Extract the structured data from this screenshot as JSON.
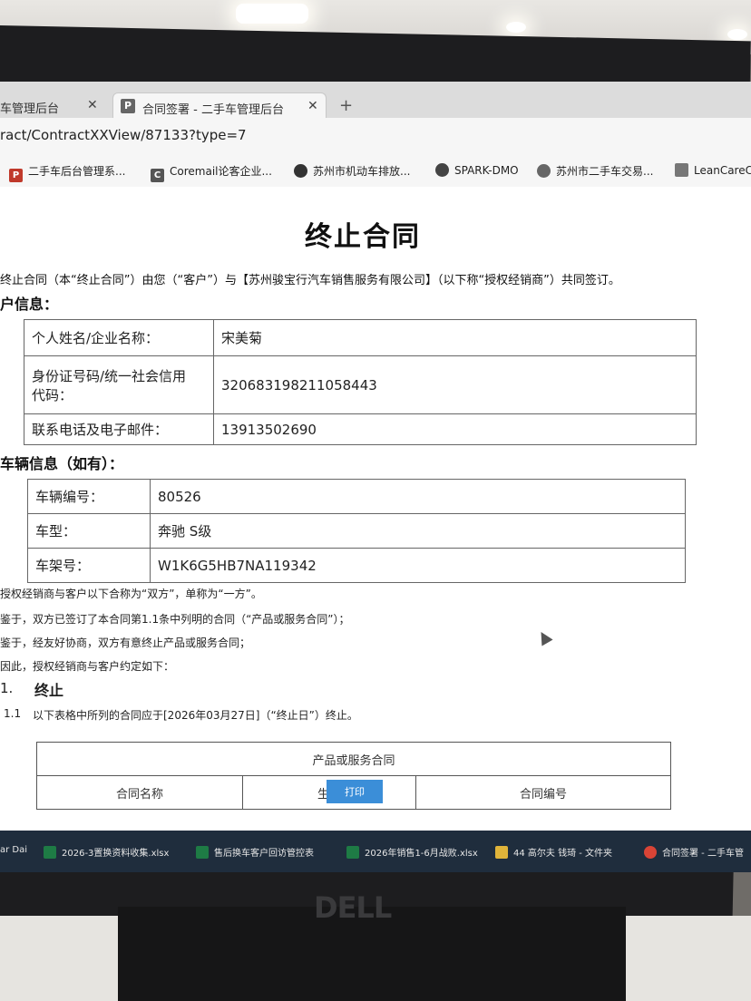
{
  "browser": {
    "tabs": [
      {
        "label": "车管理后台"
      },
      {
        "label": "合同签署 - 二手车管理后台",
        "favicon": "P"
      }
    ],
    "url": "ract/ContractXXView/87133?type=7",
    "bookmarks": [
      {
        "label": "二手车后台管理系...",
        "icon": "P"
      },
      {
        "label": "Coremail论客企业...",
        "icon": "C"
      },
      {
        "label": "苏州市机动车排放..."
      },
      {
        "label": "SPARK-DMO"
      },
      {
        "label": "苏州市二手车交易..."
      },
      {
        "label": "LeanCareC"
      }
    ]
  },
  "document": {
    "title": "终止合同",
    "intro": "终止合同（本“终止合同”）由您（“客户”）与【苏州骏宝行汽车销售服务有限公司】（以下称“授权经销商”）共同签订。",
    "customer_section": "户信息：",
    "customer_rows": [
      {
        "label": "个人姓名/企业名称：",
        "value": "宋美菊"
      },
      {
        "label_line1": "身份证号码/统一社会信用",
        "label_line2": "代码：",
        "value": "320683198211058443"
      },
      {
        "label": "联系电话及电子邮件：",
        "value": "13913502690"
      }
    ],
    "vehicle_section": "车辆信息（如有）：",
    "vehicle_rows": [
      {
        "label": "车辆编号：",
        "value": "80526"
      },
      {
        "label": "车型：",
        "value": "奔驰 S级"
      },
      {
        "label": "车架号：",
        "value": "W1K6G5HB7NA119342"
      }
    ],
    "p1": "授权经销商与客户以下合称为“双方”，单称为“一方”。",
    "p2": "鉴于，双方已签订了本合同第1.1条中列明的合同（“产品或服务合同”）；",
    "p3": "鉴于，经友好协商，双方有意终止产品或服务合同；",
    "p4": "因此，授权经销商与客户约定如下：",
    "clause_num": "1.",
    "clause_title": "终止",
    "clause_sub_num": "1.1",
    "clause_text": "以下表格中所列的合同应于[2026年03月27日]（“终止日”）终止。",
    "svc_table": {
      "header": "产品或服务合同",
      "col1": "合同名称",
      "col2": "生效",
      "col3": "合同编号"
    },
    "print_button": "打印"
  },
  "taskbar": {
    "items": [
      {
        "label": "ar Dai"
      },
      {
        "label": "2026-3置换资料收集.xlsx"
      },
      {
        "label": "售后换车客户回访管控表"
      },
      {
        "label": "2026年销售1-6月战败.xlsx"
      },
      {
        "label": "44 高尔夫 钱琦 - 文件夹"
      },
      {
        "label": "合同签署 - 二手车管"
      }
    ]
  },
  "brand": "DELL"
}
